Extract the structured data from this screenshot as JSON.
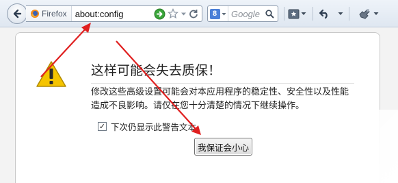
{
  "toolbar": {
    "identity_label": "Firefox",
    "url": "about:config",
    "search_placeholder": "Google",
    "search_engine_letter": "8"
  },
  "icons": {
    "back": "back-arrow-icon",
    "firefox": "firefox-logo-icon",
    "go": "go-arrow-icon",
    "bookmark_star": "bookmark-star-icon",
    "dropdown": "chevron-down-icon",
    "reload": "reload-icon",
    "search_engine": "google-search-engine-icon",
    "search": "search-icon",
    "bookmarks_menu": "bookmarks-menu-icon",
    "history_back": "history-back-icon",
    "addons": "addons-icon",
    "warning": "warning-triangle-icon",
    "annotation_arrow": "red-arrow-annotation"
  },
  "warning": {
    "title": "这样可能会失去质保！",
    "body": "修改这些高级设置可能会对本应用程序的稳定性、安全性以及性能造成不良影响。请仅在您十分清楚的情况下继续操作。",
    "checkbox_label": "下次仍显示此警告文本",
    "checkbox_checked": true,
    "checkbox_mark": "✓",
    "button_label": "我保证会小心"
  },
  "colors": {
    "annotation_arrow": "#e02020",
    "warning_icon": "#f5c400",
    "go_button": "#3aa53a"
  }
}
